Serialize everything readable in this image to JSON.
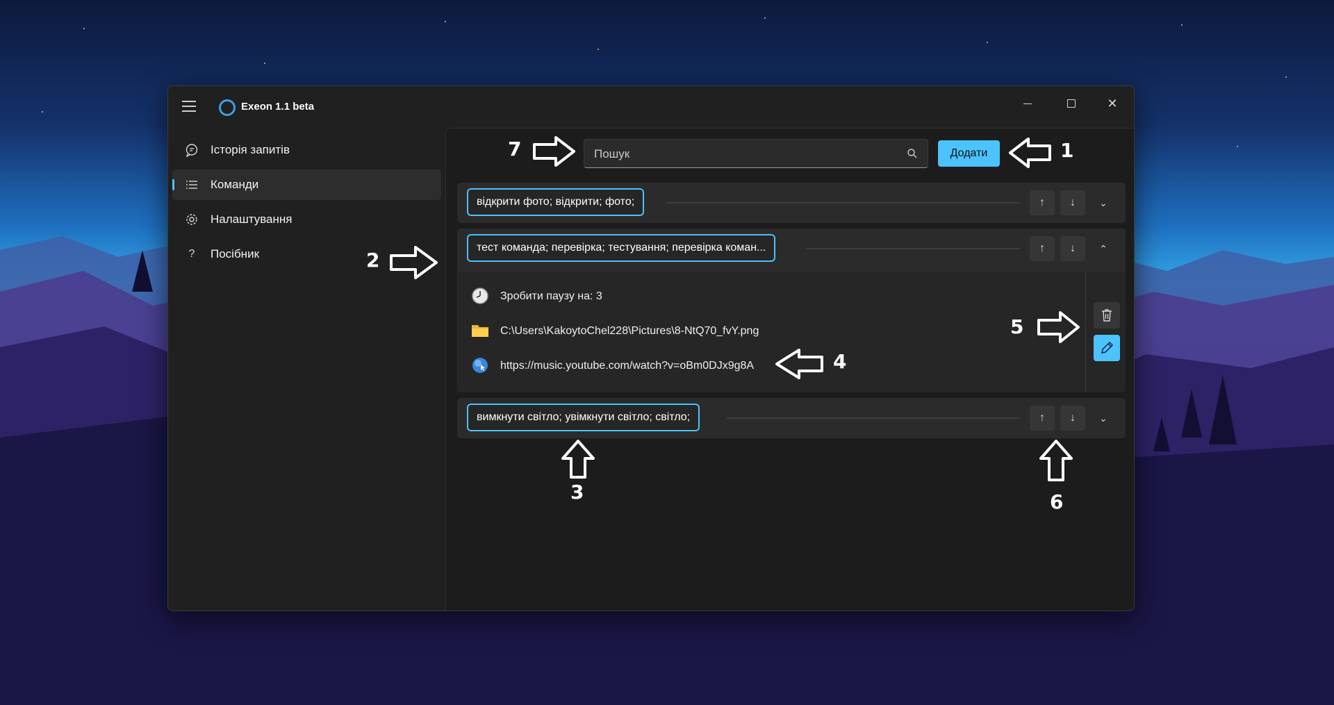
{
  "window": {
    "title": "Exeon 1.1 beta"
  },
  "sidebar": {
    "items": [
      {
        "label": "Історія запитів",
        "icon": "chat-icon"
      },
      {
        "label": "Команди",
        "icon": "list-icon",
        "active": true
      },
      {
        "label": "Налаштування",
        "icon": "gear-icon"
      },
      {
        "label": "Посібник",
        "icon": "help-icon"
      }
    ]
  },
  "toolbar": {
    "search_placeholder": "Пошук",
    "add_label": "Додати"
  },
  "commands": [
    {
      "phrases": "відкрити фото; відкрити; фото;",
      "expanded": false
    },
    {
      "phrases": "тест команда; перевірка; тестування; перевірка коман...",
      "expanded": true,
      "actions": [
        {
          "icon": "clock-icon",
          "text": "Зробити паузу на: 3"
        },
        {
          "icon": "folder-icon",
          "text": "C:\\Users\\KakoytoChel228\\Pictures\\8-NtQ70_fvY.png"
        },
        {
          "icon": "globe-icon",
          "text": "https://music.youtube.com/watch?v=oBm0DJx9g8A"
        }
      ]
    },
    {
      "phrases": "вимкнути світло; увімкнути світло; світло;",
      "expanded": false
    }
  ],
  "annotations": {
    "n1": "1",
    "n2": "2",
    "n3": "3",
    "n4": "4",
    "n5": "5",
    "n6": "6",
    "n7": "7"
  },
  "colors": {
    "accent": "#4cc2ff",
    "background": "#202020",
    "card": "#2b2b2b"
  }
}
